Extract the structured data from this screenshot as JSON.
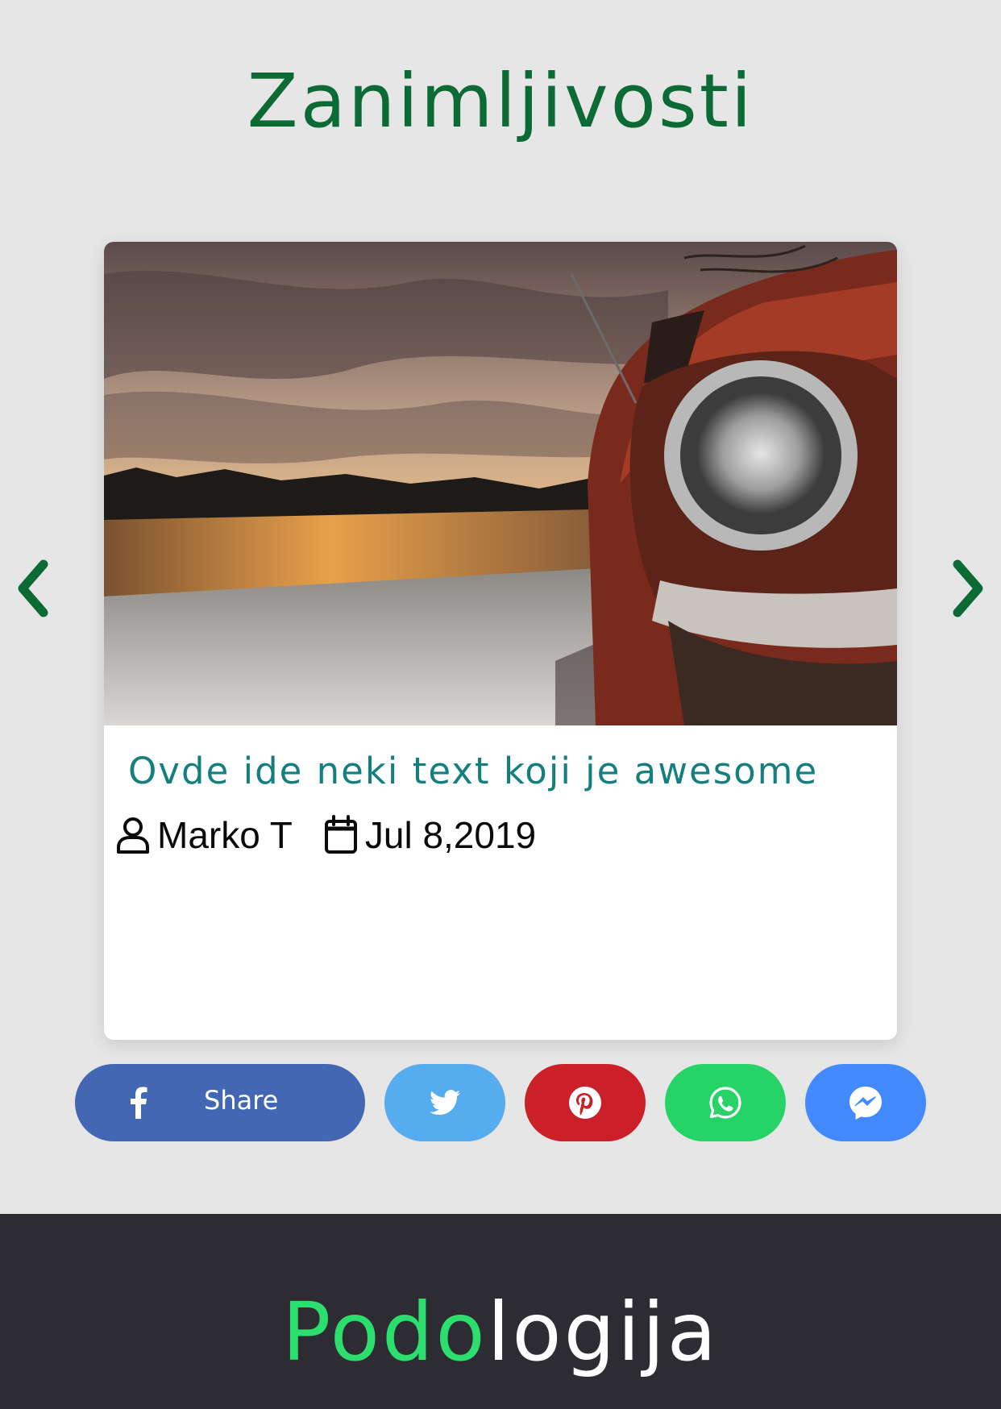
{
  "section": {
    "title": "Zanimljivosti"
  },
  "carousel": {
    "prev_icon": "chevron-left-icon",
    "next_icon": "chevron-right-icon"
  },
  "card": {
    "image_alt": "Rusty red vintage car by a snowy riverbank at sunset",
    "title": "Ovde ide neki text koji je awesome",
    "author": "Marko T",
    "date": "Jul 8,2019"
  },
  "share": {
    "facebook_label": "Share",
    "buttons": [
      "facebook-icon",
      "twitter-icon",
      "pinterest-icon",
      "whatsapp-icon",
      "messenger-icon"
    ]
  },
  "footer": {
    "logo_part1": "Podo",
    "logo_part2": "logija"
  },
  "colors": {
    "accent_green": "#0c6a34",
    "title_teal": "#157f80",
    "facebook": "#4367b3",
    "twitter": "#55acee",
    "pinterest": "#cb2027",
    "whatsapp": "#25d366",
    "messenger": "#448aff",
    "footer_bg": "#2d2c33",
    "logo_green": "#2bde6e"
  }
}
